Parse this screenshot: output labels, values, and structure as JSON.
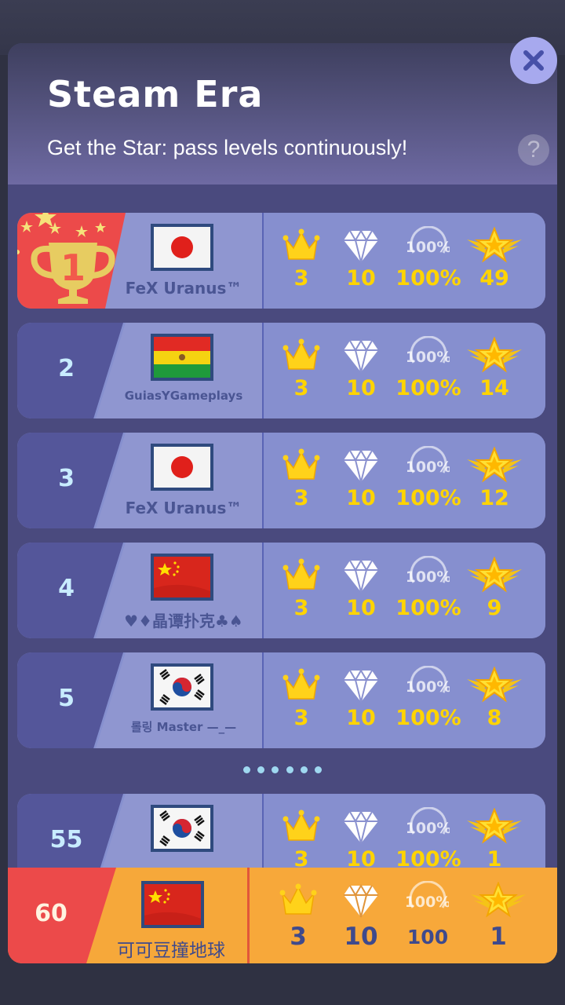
{
  "header": {
    "title": "Steam Era",
    "subtitle": "Get the Star: pass levels continuously!",
    "help_label": "?"
  },
  "colors": {
    "panel": "#4a4a7e",
    "gold": "#ffd400",
    "my_row": "#f7a83a",
    "rank_red": "#ec4a4a",
    "close_button": "#a7a9ee"
  },
  "stat_icons": [
    "crown-icon",
    "diamond-icon",
    "hundred-percent-icon",
    "winged-star-icon"
  ],
  "rows": [
    {
      "rank": "1",
      "flag": "japan",
      "name": "FeX Uranus™",
      "crowns": "3",
      "diamonds": "10",
      "perfect": "100%",
      "stars": "49"
    },
    {
      "rank": "2",
      "flag": "bolivia",
      "name": "GuiasYGameplays",
      "crowns": "3",
      "diamonds": "10",
      "perfect": "100%",
      "stars": "14"
    },
    {
      "rank": "3",
      "flag": "japan",
      "name": "FeX Uranus™",
      "crowns": "3",
      "diamonds": "10",
      "perfect": "100%",
      "stars": "12"
    },
    {
      "rank": "4",
      "flag": "china",
      "name": "♥♦晶谭扑克♣♠",
      "crowns": "3",
      "diamonds": "10",
      "perfect": "100%",
      "stars": "9"
    },
    {
      "rank": "5",
      "flag": "korea",
      "name": "롤링 Master —_—",
      "crowns": "3",
      "diamonds": "10",
      "perfect": "100%",
      "stars": "8"
    },
    {
      "rank": "55",
      "flag": "korea",
      "name": "",
      "crowns": "3",
      "diamonds": "10",
      "perfect": "100%",
      "stars": "1"
    }
  ],
  "my_row": {
    "rank": "60",
    "flag": "china",
    "name": "可可豆撞地球",
    "crowns": "3",
    "diamonds": "10",
    "perfect": "100",
    "stars": "1"
  }
}
